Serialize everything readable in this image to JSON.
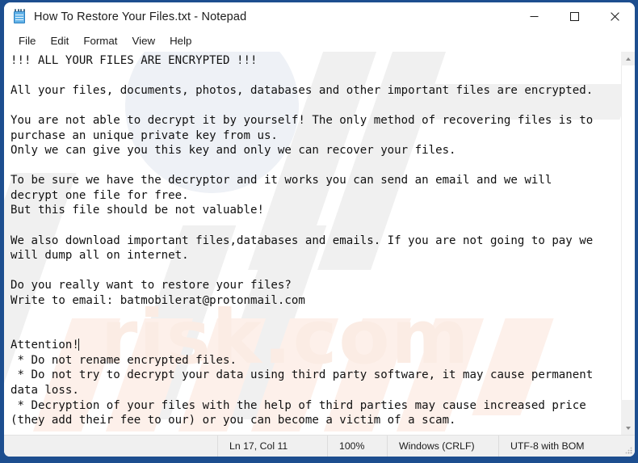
{
  "window": {
    "title": "How To Restore Your Files.txt - Notepad",
    "icon": "notepad-icon",
    "border_color": "#1d4e8f",
    "controls": {
      "minimize": "minimize-icon",
      "maximize": "maximize-icon",
      "close": "close-icon"
    }
  },
  "menu": {
    "items": [
      {
        "label": "File"
      },
      {
        "label": "Edit"
      },
      {
        "label": "Format"
      },
      {
        "label": "View"
      },
      {
        "label": "Help"
      }
    ]
  },
  "document": {
    "text_before_caret": "!!! ALL YOUR FILES ARE ENCRYPTED !!!\n\nAll your files, documents, photos, databases and other important files are encrypted.\n\nYou are not able to decrypt it by yourself! The only method of recovering files is to\npurchase an unique private key from us.\nOnly we can give you this key and only we can recover your files.\n\nTo be sure we have the decryptor and it works you can send an email and we will\ndecrypt one file for free.\nBut this file should be not valuable!\n\nWe also download important files,databases and emails. If you are not going to pay we\nwill dump all on internet.\n\nDo you really want to restore your files?\nWrite to email: batmobilerat@protonmail.com\n\n\nAttention!",
    "text_after_caret": "\n * Do not rename encrypted files.\n * Do not try to decrypt your data using third party software, it may cause permanent\ndata loss.\n * Decryption of your files with the help of third parties may cause increased price\n(they add their fee to our) or you can become a victim of a scam.",
    "contact_email": "batmobilerat@protonmail.com",
    "caret_visible": true
  },
  "scrollbar": {
    "up_arrow": "scroll-up-arrow-icon",
    "down_arrow": "scroll-down-arrow-icon",
    "thumb": "scrollbar-thumb"
  },
  "statusbar": {
    "position": "Ln 17, Col 11",
    "zoom": "100%",
    "line_ending": "Windows (CRLF)",
    "encoding": "UTF-8 with BOM",
    "grip": "resize-grip-icon"
  },
  "watermark": {
    "text": "risk.com"
  }
}
